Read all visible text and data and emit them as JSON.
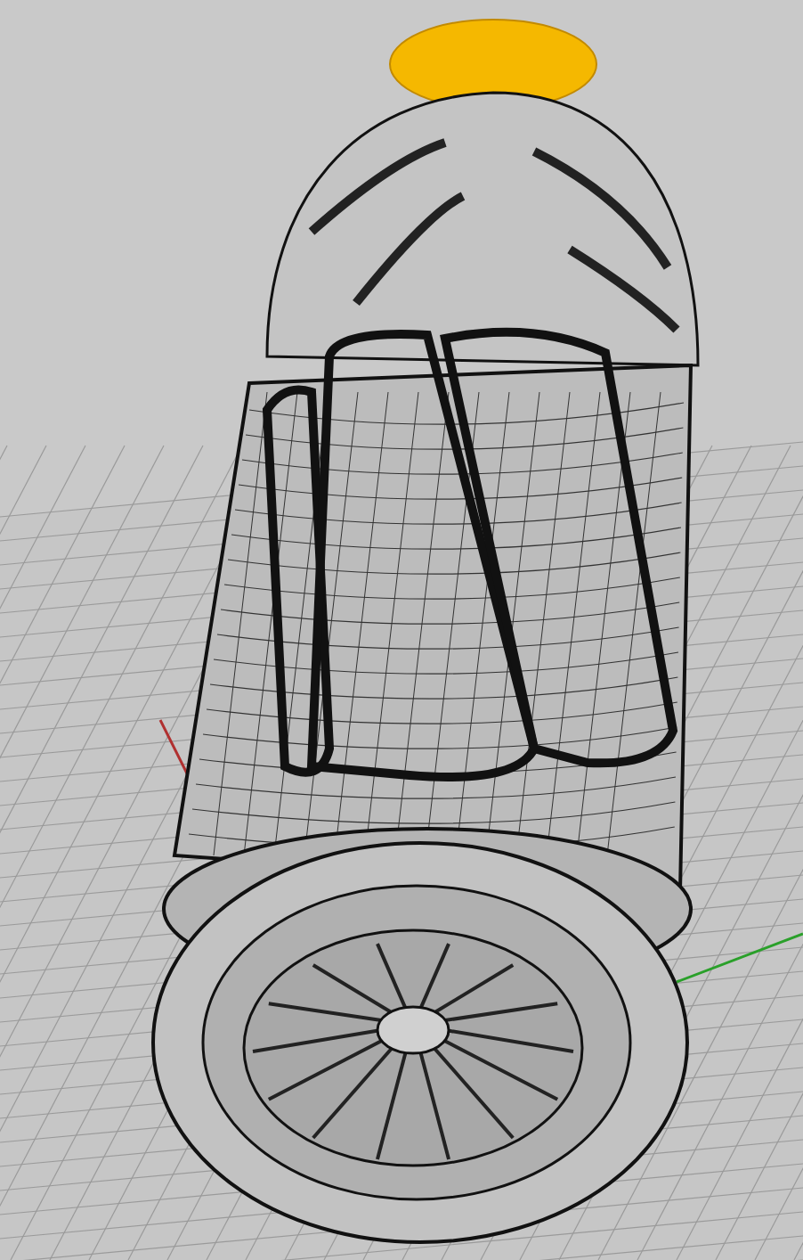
{
  "viewport": {
    "axes": [
      {
        "color": "#b03030"
      },
      {
        "color": "#2aa02a"
      }
    ]
  }
}
